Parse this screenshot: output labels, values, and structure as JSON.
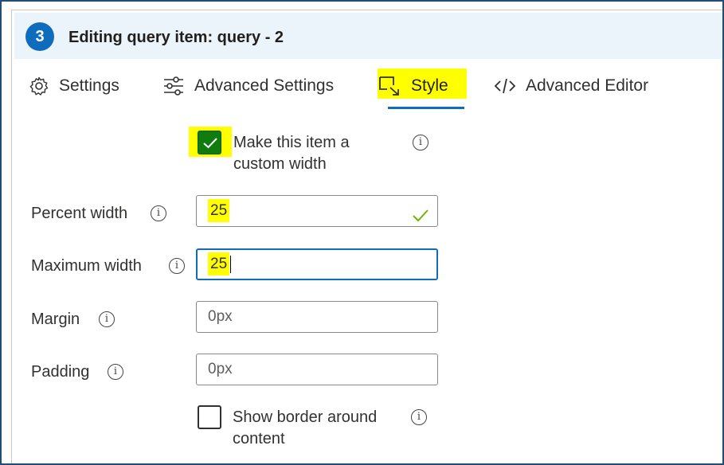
{
  "header": {
    "step_number": "3",
    "title": "Editing query item: query - 2"
  },
  "tabs": [
    {
      "label": "Settings",
      "icon": "gear-icon",
      "active": false
    },
    {
      "label": "Advanced Settings",
      "icon": "sliders-icon",
      "active": false
    },
    {
      "label": "Style",
      "icon": "resize-icon",
      "active": true
    },
    {
      "label": "Advanced Editor",
      "icon": "code-icon",
      "active": false
    }
  ],
  "custom_width_checkbox": {
    "label": "Make this item a custom width",
    "checked": true
  },
  "fields": {
    "percent_width": {
      "label": "Percent width",
      "value": "25",
      "valid": true
    },
    "maximum_width": {
      "label": "Maximum width",
      "value": "25",
      "focused": true
    },
    "margin": {
      "label": "Margin",
      "placeholder": "0px"
    },
    "padding": {
      "label": "Padding",
      "placeholder": "0px"
    }
  },
  "border_checkbox": {
    "label": "Show border around content",
    "checked": false
  },
  "colors": {
    "accent": "#0f6cbd",
    "checkbox_checked": "#107c10",
    "highlight": "#ffff00",
    "header_bg": "#eaf4fa",
    "valid_check": "#6bb700"
  }
}
